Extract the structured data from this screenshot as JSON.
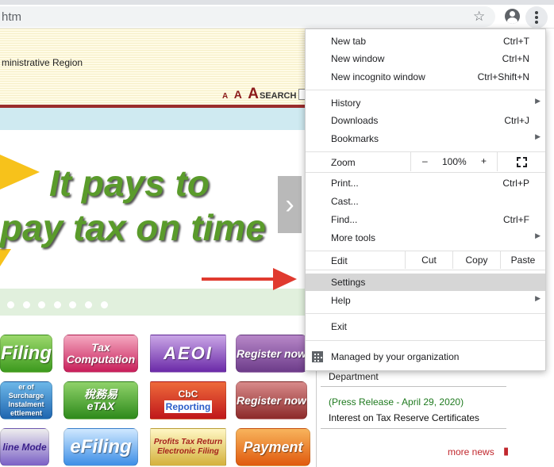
{
  "browser": {
    "url_fragment": "htm",
    "star_icon": "star-outline-icon",
    "profile_icon": "account-circle-icon",
    "menu_icon": "three-dots-vertical-icon"
  },
  "site": {
    "region_text": "ministrative Region",
    "font_sizes": [
      "A",
      "A",
      "A"
    ],
    "search_label": "SEARCH",
    "slogan_line1": "It pays to",
    "slogan_line2": "pay tax on time",
    "carousel_next_icon": "chevron-right-icon",
    "tiles": {
      "efiling1": "Filing",
      "tax_computation": "Tax Computation",
      "aeoi": "AEOI",
      "register_now_1": "Register now",
      "surcharge": "er of Surcharge Instalment ettlement",
      "etax_cn": "稅務易",
      "etax": "eTAX",
      "cbc_line1": "CbC",
      "cbc_line2": "Reporting",
      "register_now_2": "Register now",
      "online_mode": "line Mode",
      "efiling2": "eFiling",
      "profits_tax_line1": "Profits Tax Return",
      "profits_tax_line2": "Electronic Filing",
      "payment": "Payment"
    },
    "news": {
      "department": "Department",
      "press_date": "(Press Release - April 29, 2020)",
      "press_title": "Interest on Tax Reserve Certificates",
      "more_news": "more news"
    }
  },
  "menu": {
    "new_tab": {
      "label": "New tab",
      "shortcut": "Ctrl+T"
    },
    "new_window": {
      "label": "New window",
      "shortcut": "Ctrl+N"
    },
    "new_incognito": {
      "label": "New incognito window",
      "shortcut": "Ctrl+Shift+N"
    },
    "history": {
      "label": "History"
    },
    "downloads": {
      "label": "Downloads",
      "shortcut": "Ctrl+J"
    },
    "bookmarks": {
      "label": "Bookmarks"
    },
    "zoom": {
      "label": "Zoom",
      "minus": "–",
      "value": "100%",
      "plus": "+"
    },
    "print": {
      "label": "Print...",
      "shortcut": "Ctrl+P"
    },
    "cast": {
      "label": "Cast..."
    },
    "find": {
      "label": "Find...",
      "shortcut": "Ctrl+F"
    },
    "more_tools": {
      "label": "More tools"
    },
    "edit": {
      "label": "Edit",
      "cut": "Cut",
      "copy": "Copy",
      "paste": "Paste"
    },
    "settings": {
      "label": "Settings"
    },
    "help": {
      "label": "Help"
    },
    "exit": {
      "label": "Exit"
    },
    "managed": {
      "label": "Managed by your organization"
    },
    "submenu_icon": "▶"
  },
  "colors": {
    "menu_highlight": "#d6d6d6",
    "annotation_arrow": "#e03a2f",
    "slogan_green": "#5a9b2b"
  }
}
